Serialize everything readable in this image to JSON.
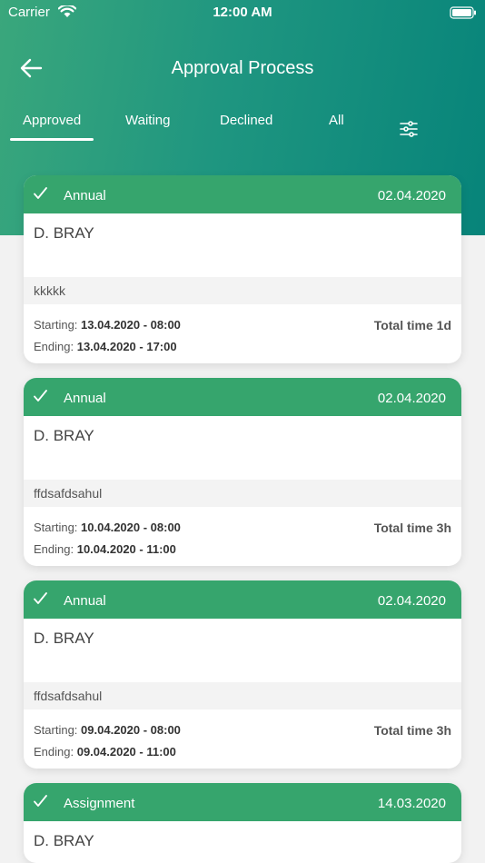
{
  "status_bar": {
    "carrier": "Carrier",
    "time": "12:00 AM"
  },
  "header": {
    "title": "Approval Process"
  },
  "tabs": [
    {
      "label": "Approved",
      "active": true
    },
    {
      "label": "Waiting",
      "active": false
    },
    {
      "label": "Declined",
      "active": false
    },
    {
      "label": "All",
      "active": false
    }
  ],
  "labels": {
    "starting": "Starting:",
    "ending": "Ending:"
  },
  "colors": {
    "header_start": "#3aa77c",
    "header_end": "#07847a",
    "card_header": "#36a56d",
    "page_bg": "#f2f2f2"
  },
  "icons": {
    "back": "arrow-left-icon",
    "filter": "sliders-icon",
    "approved": "check-icon"
  },
  "cards": [
    {
      "type": "Annual",
      "date": "02.04.2020",
      "name": "D. BRAY",
      "note": "kkkkk",
      "start": "13.04.2020 - 08:00",
      "end": "13.04.2020 - 17:00",
      "total": "Total time 1d"
    },
    {
      "type": "Annual",
      "date": "02.04.2020",
      "name": "D. BRAY",
      "note": "ffdsafdsahul",
      "start": "10.04.2020 - 08:00",
      "end": "10.04.2020 - 11:00",
      "total": "Total time 3h"
    },
    {
      "type": "Annual",
      "date": "02.04.2020",
      "name": "D. BRAY",
      "note": "ffdsafdsahul",
      "start": "09.04.2020 - 08:00",
      "end": "09.04.2020 - 11:00",
      "total": "Total time 3h"
    },
    {
      "type": "Assignment",
      "date": "14.03.2020",
      "name": "D. BRAY",
      "note": "",
      "start": "",
      "end": "",
      "total": ""
    }
  ]
}
